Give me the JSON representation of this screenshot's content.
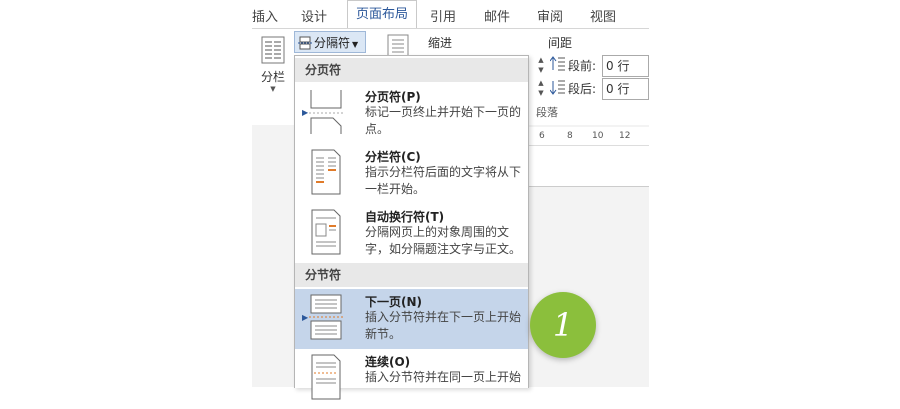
{
  "ribbon_tabs": [
    "插入",
    "设计",
    "页面布局",
    "引用",
    "邮件",
    "审阅",
    "视图"
  ],
  "active_tab": "页面布局",
  "columns_label": "分栏",
  "breaks_button_label": "分隔符",
  "indent_label": "缩进",
  "spacing_label": "间距",
  "spacing_before_label": "段前:",
  "spacing_before_value": "0 行",
  "spacing_after_label": "段后:",
  "spacing_after_value": "0 行",
  "paragraph_group_label": "段落",
  "ruler_ticks": [
    "6",
    "8",
    "10",
    "12"
  ],
  "menu": {
    "page_breaks_header": "分页符",
    "section_breaks_header": "分节符",
    "items": [
      {
        "title": "分页符(P)",
        "desc": "标记一页终止并开始下一页的点。",
        "icon": "page-break-icon"
      },
      {
        "title": "分栏符(C)",
        "desc": "指示分栏符后面的文字将从下一栏开始。",
        "icon": "column-break-icon"
      },
      {
        "title": "自动换行符(T)",
        "desc": "分隔网页上的对象周围的文字，如分隔题注文字与正文。",
        "icon": "text-wrapping-break-icon"
      },
      {
        "title": "下一页(N)",
        "desc": "插入分节符并在下一页上开始新节。",
        "icon": "next-page-section-icon"
      },
      {
        "title": "连续(O)",
        "desc": "插入分节符并在同一页上开始",
        "icon": "continuous-section-icon"
      }
    ]
  },
  "step_badge": "1",
  "colors": {
    "accent": "#2b579a",
    "highlight": "#c5d5ea",
    "badge": "#8bbf3c"
  }
}
